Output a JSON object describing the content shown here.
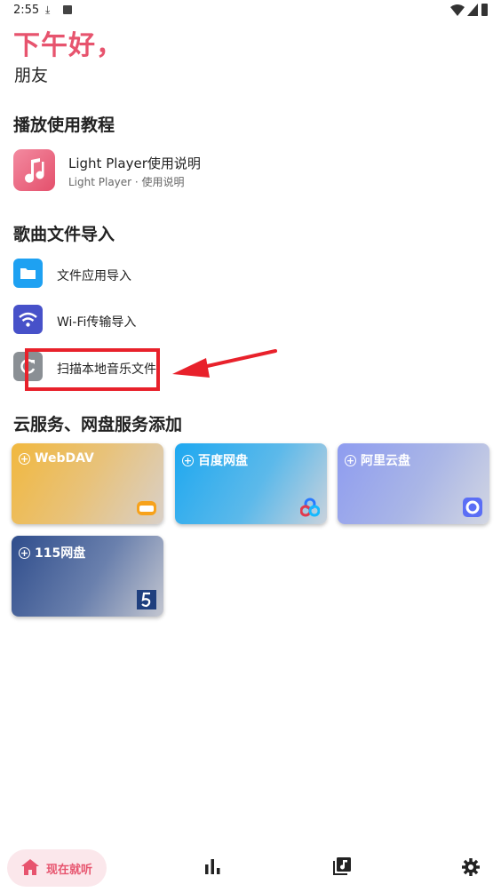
{
  "status_bar": {
    "time": "2:55"
  },
  "greeting": {
    "title": "下午好，",
    "name": "朋友"
  },
  "tutorial": {
    "section_title": "播放使用教程",
    "item_title": "Light Player使用说明",
    "item_subtitle": "Light Player · 使用说明"
  },
  "import": {
    "section_title": "歌曲文件导入",
    "items": [
      {
        "label": "文件应用导入",
        "icon": "folder-icon",
        "color": "#1ea1f2"
      },
      {
        "label": "Wi-Fi传输导入",
        "icon": "wifi-icon",
        "color": "#4751c9"
      },
      {
        "label": "扫描本地音乐文件",
        "icon": "refresh-icon",
        "color": "#8a8f94"
      }
    ]
  },
  "cloud": {
    "section_title": "云服务、网盘服务添加",
    "cards": [
      {
        "label": "WebDAV",
        "icon": "webdav-logo-icon"
      },
      {
        "label": "百度网盘",
        "icon": "baidu-logo-icon"
      },
      {
        "label": "阿里云盘",
        "icon": "aliyun-logo-icon"
      },
      {
        "label": "115网盘",
        "icon": "115-logo-icon"
      }
    ]
  },
  "nav": {
    "home_label": "现在就听"
  },
  "colors": {
    "accent": "#e7546e",
    "annotation": "#e8212b"
  }
}
